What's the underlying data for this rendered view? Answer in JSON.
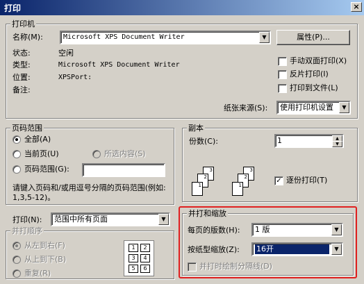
{
  "window": {
    "title": "打印",
    "close_label": "×"
  },
  "printer": {
    "group_label": "打印机",
    "name_label": "名称(M):",
    "name_value": "Microsoft XPS Document Writer",
    "properties_button": "属性(P)...",
    "status_label": "状态:",
    "status_value": "空闲",
    "type_label": "类型:",
    "type_value": "Microsoft XPS Document Writer",
    "where_label": "位置:",
    "where_value": "XPSPort:",
    "comment_label": "备注:",
    "manual_duplex": "手动双面打印(X)",
    "reverse_print": "反片打印(I)",
    "print_to_file": "打印到文件(L)",
    "paper_source_label": "纸张来源(S):",
    "paper_source_value": "使用打印机设置"
  },
  "page_range": {
    "group_label": "页码范围",
    "all": "全部(A)",
    "current_page": "当前页(U)",
    "selection": "所选内容(S)",
    "pages": "页码范围(G):",
    "pages_value": "",
    "hint": "请键入页码和/或用逗号分隔的页码范围(例如: 1,3,5-12)。"
  },
  "copies": {
    "group_label": "副本",
    "count_label": "份数(C):",
    "count_value": "1",
    "collate": "逐份打印(T)",
    "page_nums": [
      "3",
      "2",
      "1",
      "3",
      "2",
      "1"
    ]
  },
  "print_what": {
    "label": "打印(N):",
    "value": "范围中所有页面"
  },
  "order": {
    "group_label": "并打顺序",
    "left_to_right": "从左到右(F)",
    "top_to_bottom": "从上到下(B)",
    "repeat": "重复(R)",
    "grid_nums": [
      "1",
      "2",
      "3",
      "4",
      "5",
      "6"
    ]
  },
  "zoom": {
    "group_label": "并打和缩放",
    "pages_per_sheet_label": "每页的版数(H):",
    "pages_per_sheet_value": "1 版",
    "scale_to_paper_label": "按纸型缩放(Z):",
    "scale_to_paper_value": "16开",
    "draw_borders": "并打时绘制分隔线(D)"
  },
  "colors": {
    "highlight": "#e02020",
    "selection": "#0a246a"
  }
}
